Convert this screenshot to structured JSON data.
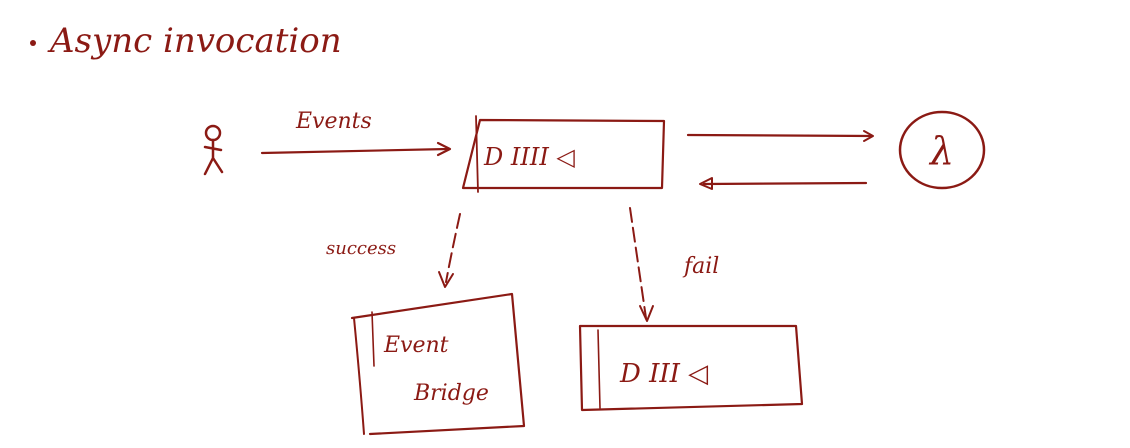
{
  "title": "Async invocation",
  "edge_labels": {
    "events": "Events",
    "success": "success",
    "fail": "fail"
  },
  "nodes": {
    "event_queue": "D IIII ◁",
    "lambda_symbol": "λ",
    "event_bridge_line1": "Event",
    "event_bridge_line2": "Bridge",
    "dead_letter_queue": "D III ◁"
  },
  "colors": {
    "ink": "#8b1a14",
    "background": "#ffffff"
  }
}
